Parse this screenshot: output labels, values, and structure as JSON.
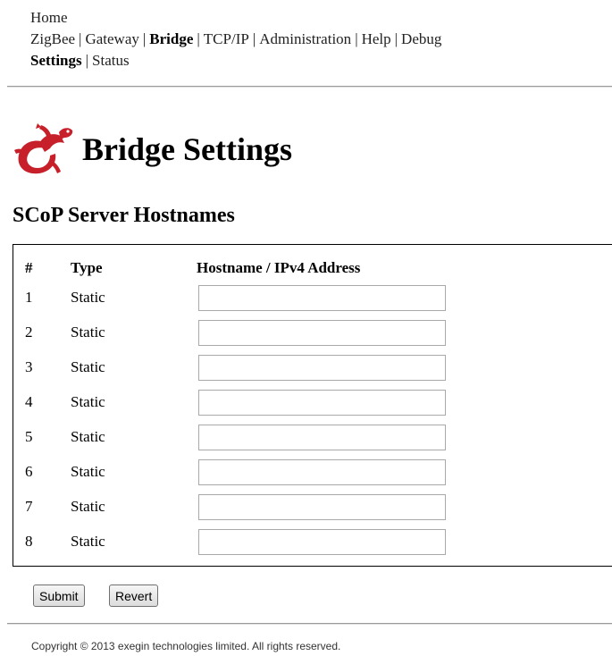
{
  "nav": {
    "row1": [
      {
        "label": "Home"
      }
    ],
    "row2": [
      {
        "label": "ZigBee",
        "active": false
      },
      {
        "label": "Gateway",
        "active": false
      },
      {
        "label": "Bridge",
        "active": true
      },
      {
        "label": "TCP/IP",
        "active": false
      },
      {
        "label": "Administration",
        "active": false
      },
      {
        "label": "Help",
        "active": false
      },
      {
        "label": "Debug",
        "active": false
      }
    ],
    "row3": [
      {
        "label": "Settings",
        "active": true
      },
      {
        "label": "Status",
        "active": false
      }
    ],
    "separator": "|"
  },
  "page": {
    "title": "Bridge Settings",
    "logo_icon": "red-gecko-logo",
    "logo_color": "#c8202a"
  },
  "section": {
    "title": "SCoP Server Hostnames"
  },
  "table": {
    "headers": {
      "num": "#",
      "type": "Type",
      "hostname": "Hostname / IPv4 Address"
    },
    "rows": [
      {
        "num": "1",
        "type": "Static",
        "hostname": ""
      },
      {
        "num": "2",
        "type": "Static",
        "hostname": ""
      },
      {
        "num": "3",
        "type": "Static",
        "hostname": ""
      },
      {
        "num": "4",
        "type": "Static",
        "hostname": ""
      },
      {
        "num": "5",
        "type": "Static",
        "hostname": ""
      },
      {
        "num": "6",
        "type": "Static",
        "hostname": ""
      },
      {
        "num": "7",
        "type": "Static",
        "hostname": ""
      },
      {
        "num": "8",
        "type": "Static",
        "hostname": ""
      }
    ]
  },
  "buttons": {
    "submit_label": "Submit",
    "revert_label": "Revert"
  },
  "footer": {
    "copyright": "Copyright © 2013 exegin technologies limited. All rights reserved."
  }
}
